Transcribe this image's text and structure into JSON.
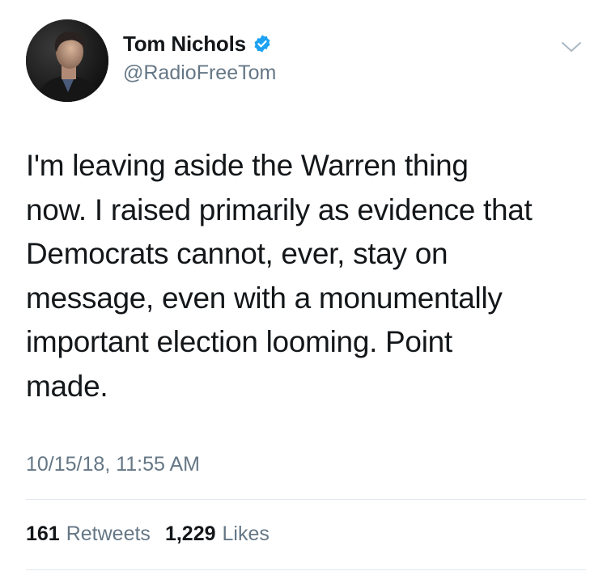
{
  "author": {
    "display_name": "Tom Nichols",
    "handle": "@RadioFreeTom",
    "verified": true
  },
  "tweet": {
    "text": "I'm leaving aside the Warren thing\nnow. I raised primarily as evidence that\nDemocrats cannot, ever, stay on\nmessage, even with a monumentally\nimportant election looming. Point\nmade.",
    "timestamp": "10/15/18, 11:55 AM"
  },
  "stats": {
    "retweets_count": "161",
    "retweets_label": "Retweets",
    "likes_count": "1,229",
    "likes_label": "Likes"
  },
  "icons": {
    "verified": "verified-badge-icon",
    "menu": "chevron-down-icon"
  },
  "colors": {
    "verified_blue": "#1da1f2",
    "secondary_text": "#657786",
    "primary_text": "#14171a",
    "divider": "#e1e8ed"
  }
}
